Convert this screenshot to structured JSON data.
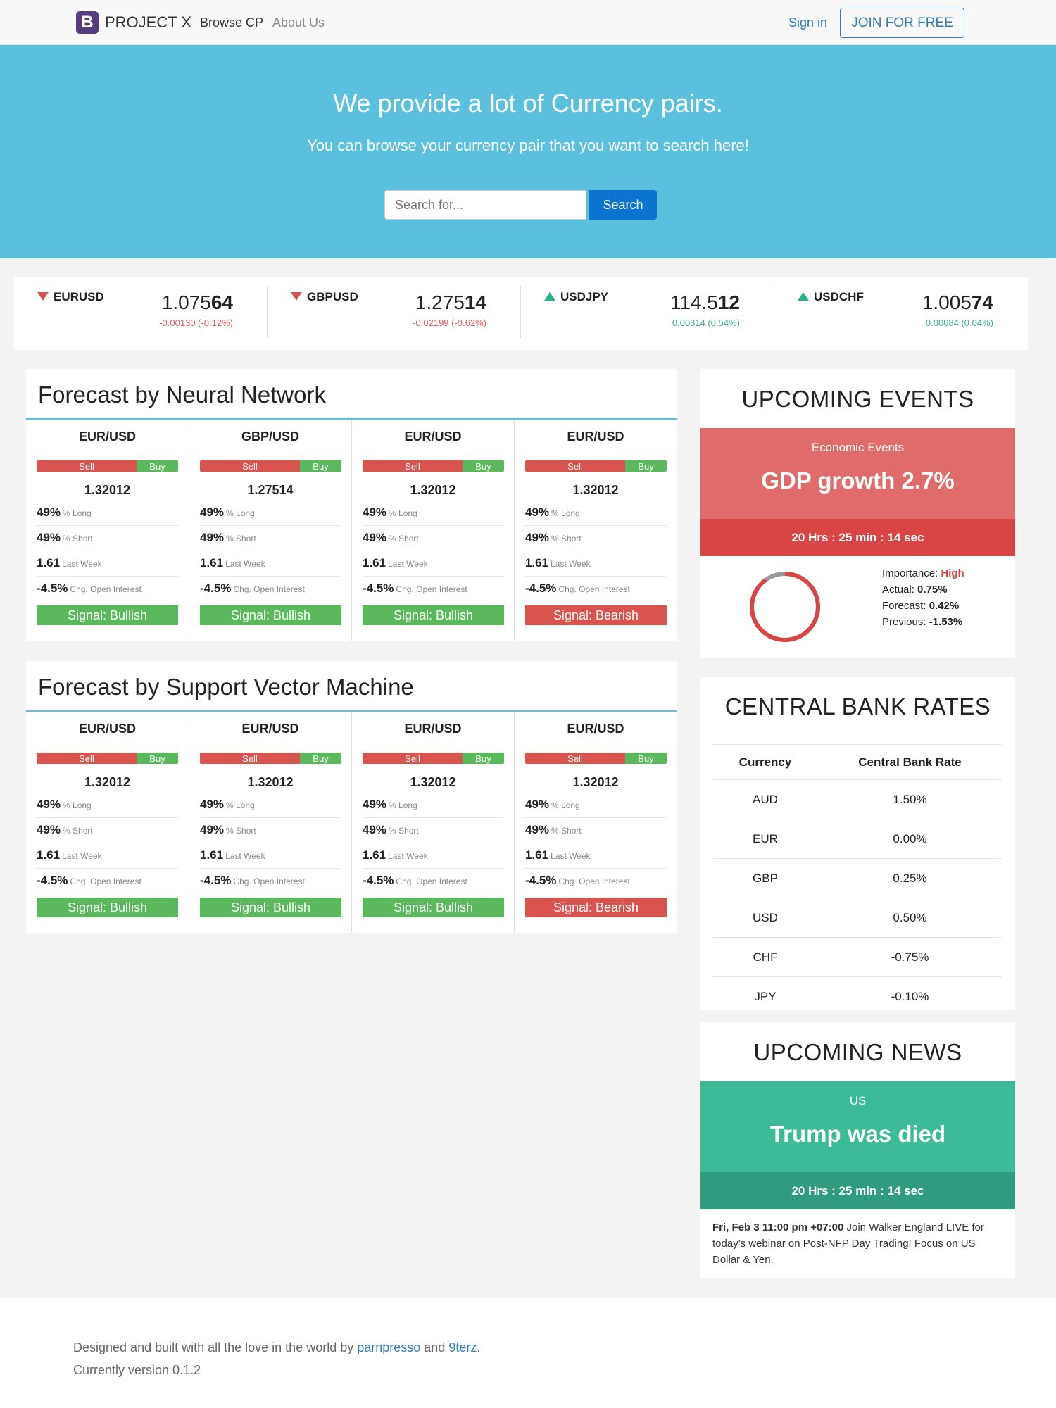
{
  "navbar": {
    "brand_letter": "B",
    "brand_name": "PROJECT X",
    "links": [
      "Browse CP",
      "About Us"
    ],
    "signin": "Sign in",
    "join": "JOIN FOR FREE"
  },
  "hero": {
    "title": "We provide a lot of Currency pairs.",
    "subtitle": "You can browse your currency pair that you want to search here!",
    "search_placeholder": "Search for...",
    "search_button": "Search"
  },
  "ticker": [
    {
      "symbol": "EURUSD",
      "direction": "down",
      "price_main": "1.075",
      "price_bold": "64",
      "change": "-0.00130 (-0.12%)"
    },
    {
      "symbol": "GBPUSD",
      "direction": "down",
      "price_main": "1.275",
      "price_bold": "14",
      "change": "-0.02199 (-0.62%)"
    },
    {
      "symbol": "USDJPY",
      "direction": "up",
      "price_main": "114.5",
      "price_bold": "12",
      "change": "0.00314 (0.54%)"
    },
    {
      "symbol": "USDCHF",
      "direction": "up",
      "price_main": "1.005",
      "price_bold": "74",
      "change": "0.00084 (0.04%)"
    }
  ],
  "labels": {
    "sell": "Sell",
    "buy": "Buy",
    "long": "% Long",
    "short": "% Short",
    "last_week": "Last Week",
    "chg_oi": "Chg. Open Interest"
  },
  "forecast_nn": {
    "title": "Forecast by Neural Network",
    "columns": [
      {
        "pair": "EUR/USD",
        "price": "1.32012",
        "long": "49%",
        "short": "49%",
        "last_week": "1.61",
        "chg_oi": "-4.5%",
        "signal": "Signal: Bullish",
        "signal_type": "bull"
      },
      {
        "pair": "GBP/USD",
        "price": "1.27514",
        "long": "49%",
        "short": "49%",
        "last_week": "1.61",
        "chg_oi": "-4.5%",
        "signal": "Signal: Bullish",
        "signal_type": "bull"
      },
      {
        "pair": "EUR/USD",
        "price": "1.32012",
        "long": "49%",
        "short": "49%",
        "last_week": "1.61",
        "chg_oi": "-4.5%",
        "signal": "Signal: Bullish",
        "signal_type": "bull"
      },
      {
        "pair": "EUR/USD",
        "price": "1.32012",
        "long": "49%",
        "short": "49%",
        "last_week": "1.61",
        "chg_oi": "-4.5%",
        "signal": "Signal: Bearish",
        "signal_type": "bear"
      }
    ]
  },
  "forecast_svm": {
    "title": "Forecast by Support Vector Machine",
    "columns": [
      {
        "pair": "EUR/USD",
        "price": "1.32012",
        "long": "49%",
        "short": "49%",
        "last_week": "1.61",
        "chg_oi": "-4.5%",
        "signal": "Signal: Bullish",
        "signal_type": "bull"
      },
      {
        "pair": "EUR/USD",
        "price": "1.32012",
        "long": "49%",
        "short": "49%",
        "last_week": "1.61",
        "chg_oi": "-4.5%",
        "signal": "Signal: Bullish",
        "signal_type": "bull"
      },
      {
        "pair": "EUR/USD",
        "price": "1.32012",
        "long": "49%",
        "short": "49%",
        "last_week": "1.61",
        "chg_oi": "-4.5%",
        "signal": "Signal: Bullish",
        "signal_type": "bull"
      },
      {
        "pair": "EUR/USD",
        "price": "1.32012",
        "long": "49%",
        "short": "49%",
        "last_week": "1.61",
        "chg_oi": "-4.5%",
        "signal": "Signal: Bearish",
        "signal_type": "bear"
      }
    ]
  },
  "events": {
    "title": "UPCOMING EVENTS",
    "label": "Economic Events",
    "headline": "GDP growth 2.7%",
    "timer": "20 Hrs : 25 min : 14 sec",
    "importance_label": "Importance:",
    "importance": "High",
    "actual_label": "Actual:",
    "actual": "0.75%",
    "forecast_label": "Forecast:",
    "forecast": "0.42%",
    "previous_label": "Previous:",
    "previous": "-1.53%",
    "donut_fraction": 0.9
  },
  "rates": {
    "title": "CENTRAL BANK RATES",
    "header": [
      "Currency",
      "Central Bank Rate"
    ],
    "rows": [
      [
        "AUD",
        "1.50%"
      ],
      [
        "EUR",
        "0.00%"
      ],
      [
        "GBP",
        "0.25%"
      ],
      [
        "USD",
        "0.50%"
      ],
      [
        "CHF",
        "-0.75%"
      ],
      [
        "JPY",
        "-0.10%"
      ]
    ]
  },
  "news": {
    "title": "UPCOMING NEWS",
    "region": "US",
    "headline": "Trump was died",
    "timer": "20 Hrs : 25 min : 14 sec",
    "date": "Fri, Feb 3 11:00 pm +07:00",
    "text": " Join Walker England LIVE for today's webinar on Post-NFP Day Trading! Focus on US Dollar & Yen."
  },
  "footer": {
    "line1_prefix": "Designed and built with all the love in the world by ",
    "author1": "parnpresso",
    "and": " and ",
    "author2": "9terz",
    "period": ".",
    "line2": "Currently version 0.1.2"
  },
  "colors": {
    "hero": "#5bc0de",
    "sell": "#d9534f",
    "buy": "#5cb85c",
    "events": "#e06b6b",
    "news": "#3dbb98"
  }
}
